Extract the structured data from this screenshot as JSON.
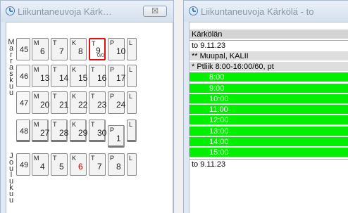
{
  "windows": {
    "left": {
      "title": "Liikuntaneuvoja Kärk…",
      "close": "☒"
    },
    "right": {
      "title": "Liikuntaneuvoja Kärkölä - to"
    }
  },
  "calendar": {
    "month_top": "Marraskuu",
    "month_bottom": "Joulukuu",
    "rows": [
      {
        "week": "45",
        "days": [
          {
            "wd": "M",
            "d": "6"
          },
          {
            "wd": "T",
            "d": "7"
          },
          {
            "wd": "K",
            "d": "8"
          },
          {
            "wd": "T",
            "d": "9",
            "sub": "0/0",
            "selected": true
          },
          {
            "wd": "P",
            "d": "10"
          },
          {
            "wd": "L",
            "d": ""
          }
        ]
      },
      {
        "week": "46",
        "days": [
          {
            "wd": "M",
            "d": "13"
          },
          {
            "wd": "T",
            "d": "14"
          },
          {
            "wd": "K",
            "d": "15"
          },
          {
            "wd": "T",
            "d": "16"
          },
          {
            "wd": "P",
            "d": "17"
          },
          {
            "wd": "L",
            "d": ""
          }
        ]
      },
      {
        "week": "47",
        "days": [
          {
            "wd": "M",
            "d": "20"
          },
          {
            "wd": "T",
            "d": "21"
          },
          {
            "wd": "K",
            "d": "22"
          },
          {
            "wd": "T",
            "d": "23"
          },
          {
            "wd": "P",
            "d": "24"
          },
          {
            "wd": "L",
            "d": ""
          }
        ]
      },
      {
        "week": "48",
        "days": [
          {
            "wd": "M",
            "d": "27"
          },
          {
            "wd": "T",
            "d": "28"
          },
          {
            "wd": "K",
            "d": "29"
          },
          {
            "wd": "T",
            "d": "30"
          },
          {
            "wd": "P",
            "d": "1"
          },
          {
            "wd": "L",
            "d": ""
          }
        ]
      },
      {
        "week": "49",
        "days": [
          {
            "wd": "M",
            "d": "4"
          },
          {
            "wd": "T",
            "d": "5"
          },
          {
            "wd": "K",
            "d": "6",
            "red": true
          },
          {
            "wd": "T",
            "d": "7"
          },
          {
            "wd": "P",
            "d": "8"
          },
          {
            "wd": "L",
            "d": ""
          }
        ]
      }
    ]
  },
  "schedule": {
    "location": "Kärkölän",
    "date": "to 9.11.23",
    "group": "** Muupal, KALII",
    "entry": "*  Ptliik  8:00-16:00/60, pt",
    "slots": [
      "8:00",
      "9:00",
      "10:00",
      "11:00",
      "12:00",
      "13:00",
      "14:00",
      "15:00"
    ],
    "next_date": "to 9.11.23"
  },
  "colors": {
    "slot_free": "#00f000",
    "selected_day": "#e01010",
    "holiday": "#c00000"
  }
}
